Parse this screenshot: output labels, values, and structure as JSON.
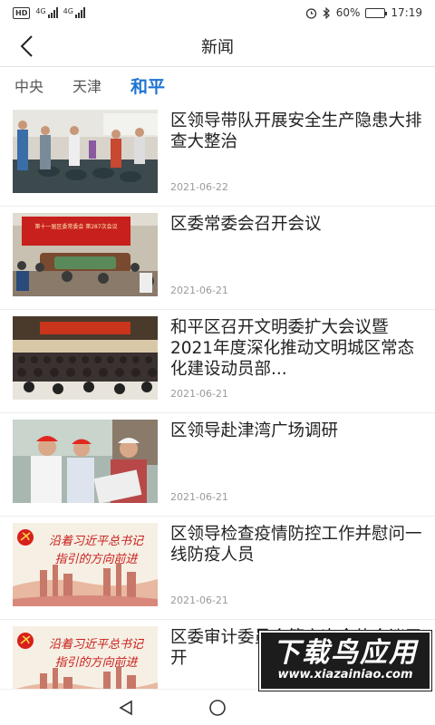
{
  "status_bar": {
    "hd_label": "HD",
    "sim1_label": "4G",
    "sim2_label": "4G",
    "battery_text": "60%",
    "battery_level": 0.6,
    "time": "17:19"
  },
  "header": {
    "title": "新闻"
  },
  "tabs": [
    {
      "label": "中央",
      "active": false
    },
    {
      "label": "天津",
      "active": false
    },
    {
      "label": "和平",
      "active": true
    }
  ],
  "news": [
    {
      "title": "区领导带队开展安全生产隐患大排查大整治",
      "date": "2021-06-22",
      "image": "inspection"
    },
    {
      "title": "区委常委会召开会议",
      "date": "2021-06-21",
      "image": "meeting",
      "image_banner": "第十一届区委常委会 第287次会议"
    },
    {
      "title": "和平区召开文明委扩大会议暨2021年度深化推动文明城区常态化建设动员部...",
      "date": "2021-06-21",
      "image": "auditorium"
    },
    {
      "title": "区领导赴津湾广场调研",
      "date": "2021-06-21",
      "image": "survey"
    },
    {
      "title": "区领导检查疫情防控工作并慰问一线防疫人员",
      "date": "2021-06-21",
      "image": "poster",
      "image_slogan_1": "沿着习近平总书记",
      "image_slogan_2": "指引的方向前进"
    },
    {
      "title": "区委审计委员会第六次全体会议召开",
      "date": "",
      "image": "poster",
      "image_slogan_1": "沿着习近平总书记",
      "image_slogan_2": "指引的方向前进"
    }
  ],
  "watermark": {
    "main": "下载鸟应用",
    "sub": "www.xiazainiao.com"
  },
  "colors": {
    "accent": "#1e73d2",
    "date": "#9a9a9a",
    "divider": "#ececec"
  }
}
